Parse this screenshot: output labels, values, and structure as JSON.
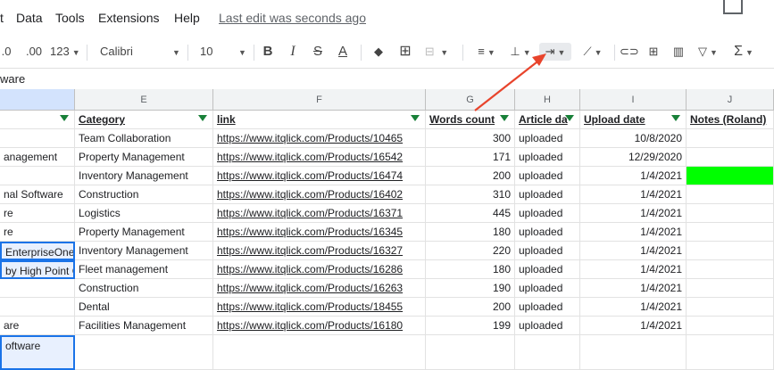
{
  "menu": {
    "items": [
      "t",
      "Data",
      "Tools",
      "Extensions",
      "Help"
    ],
    "last_edit": "Last edit was seconds ago"
  },
  "toolbar": {
    "decimal_less": ".0",
    "decimal_more": ".00",
    "number_format": "123",
    "font": "Calibri",
    "font_size": "10",
    "bold": "B",
    "italic": "I",
    "strike": "S",
    "text_color": "A",
    "sum": "Σ"
  },
  "formula_bar": {
    "value": "ware"
  },
  "columns": [
    {
      "letter": "E"
    },
    {
      "letter": "F"
    },
    {
      "letter": "G"
    },
    {
      "letter": "H"
    },
    {
      "letter": "I"
    },
    {
      "letter": "J"
    }
  ],
  "headers": {
    "d": "",
    "category": "Category",
    "link": "link",
    "words": "Words count",
    "article": "Article da",
    "upload": "Upload date",
    "notes": "Notes (Roland)"
  },
  "rows": [
    {
      "d": "",
      "cat": "Team Collaboration",
      "link": "https://www.itqlick.com/Products/10465",
      "words": "300",
      "article": "uploaded",
      "date": "10/8/2020"
    },
    {
      "d": "anagement",
      "cat": "Property Management",
      "link": "https://www.itqlick.com/Products/16542",
      "words": "171",
      "article": "uploaded",
      "date": "12/29/2020"
    },
    {
      "d": "",
      "cat": "Inventory Management",
      "link": "https://www.itqlick.com/Products/16474",
      "words": "200",
      "article": "uploaded",
      "date": "1/4/2021"
    },
    {
      "d": "nal Software",
      "cat": "Construction",
      "link": "https://www.itqlick.com/Products/16402",
      "words": "310",
      "article": "uploaded",
      "date": "1/4/2021"
    },
    {
      "d": "re",
      "cat": "Logistics",
      "link": "https://www.itqlick.com/Products/16371",
      "words": "445",
      "article": "uploaded",
      "date": "1/4/2021"
    },
    {
      "d": "re",
      "cat": "Property Management",
      "link": "https://www.itqlick.com/Products/16345",
      "words": "180",
      "article": "uploaded",
      "date": "1/4/2021"
    },
    {
      "d": "EnterpriseOne",
      "cat": "Inventory Management",
      "link": "https://www.itqlick.com/Products/16327",
      "words": "220",
      "article": "uploaded",
      "date": "1/4/2021"
    },
    {
      "d": "by High Point G",
      "cat": "Fleet management",
      "link": "https://www.itqlick.com/Products/16286",
      "words": "180",
      "article": "uploaded",
      "date": "1/4/2021"
    },
    {
      "d": "",
      "cat": "Construction",
      "link": "https://www.itqlick.com/Products/16263",
      "words": "190",
      "article": "uploaded",
      "date": "1/4/2021"
    },
    {
      "d": "",
      "cat": "Dental",
      "link": "https://www.itqlick.com/Products/18455",
      "words": "200",
      "article": "uploaded",
      "date": "1/4/2021"
    },
    {
      "d": "are",
      "cat": "Facilities Management",
      "link": "https://www.itqlick.com/Products/16180",
      "words": "199",
      "article": "uploaded",
      "date": "1/4/2021"
    }
  ],
  "last_row": {
    "d": "oftware"
  },
  "colors": {
    "accent": "#1a73e8",
    "highlight_green": "#00ff00",
    "arrow": "#e8442c"
  }
}
